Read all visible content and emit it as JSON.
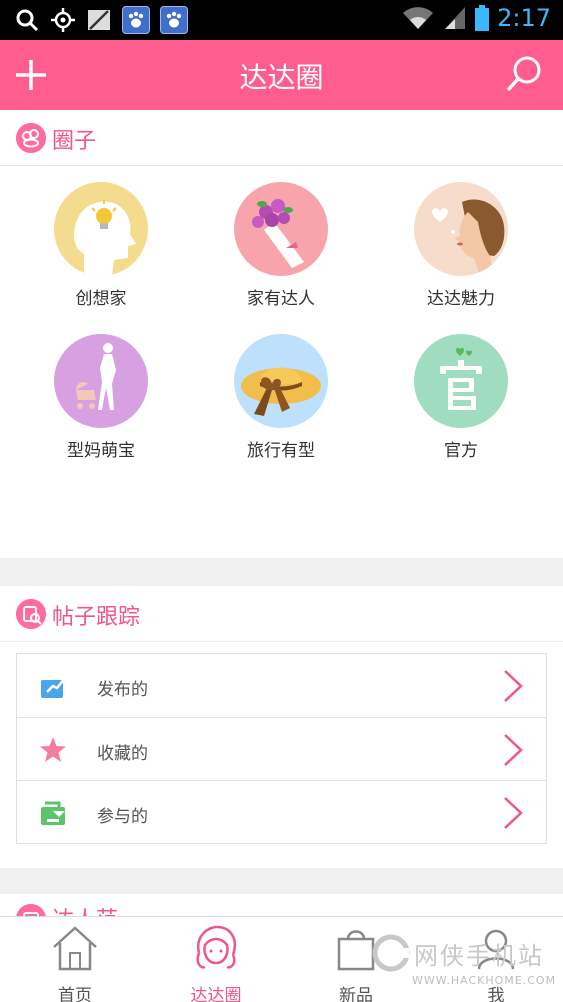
{
  "status_bar": {
    "time": "2:17",
    "notification_icons": [
      "search-icon",
      "gps-icon",
      "no-sim-icon",
      "baidu-paw-icon",
      "baidu-paw-icon"
    ],
    "status_icons": [
      "wifi-icon",
      "signal-icon",
      "battery-icon"
    ]
  },
  "header": {
    "title": "达达圈",
    "left_icon": "plus-icon",
    "right_icon": "search-icon",
    "color": "#ff5d8f"
  },
  "circles_section": {
    "title": "圈子",
    "items": [
      {
        "label": "创想家",
        "icon": "lightbulb-head-icon",
        "bg": "#f3dc8e"
      },
      {
        "label": "家有达人",
        "icon": "bouquet-icon",
        "bg": "#f7a4ad"
      },
      {
        "label": "达达魅力",
        "icon": "woman-profile-icon",
        "bg": "#f6dccb"
      },
      {
        "label": "型妈萌宝",
        "icon": "mother-stroller-icon",
        "bg": "#d7a0e0"
      },
      {
        "label": "旅行有型",
        "icon": "sun-hat-icon",
        "bg": "#bde0fb"
      },
      {
        "label": "官方",
        "icon": "official-icon",
        "bg": "#9fdcc0"
      }
    ]
  },
  "tracking_section": {
    "title": "帖子跟踪",
    "rows": [
      {
        "label": "发布的",
        "icon": "publish-icon"
      },
      {
        "label": "收藏的",
        "icon": "star-icon"
      },
      {
        "label": "参与的",
        "icon": "participate-icon"
      }
    ]
  },
  "partial_section": {
    "title": "达人范"
  },
  "tab_bar": {
    "tabs": [
      {
        "label": "首页",
        "icon": "home-icon",
        "active": false
      },
      {
        "label": "达达圈",
        "icon": "girl-face-icon",
        "active": true
      },
      {
        "label": "新品",
        "icon": "shopping-bag-icon",
        "active": false
      },
      {
        "label": "我",
        "icon": "profile-icon",
        "active": false
      }
    ]
  },
  "watermark": {
    "text": "网侠手机站",
    "url": "WWW.HACKHOME.COM"
  },
  "colors": {
    "accent": "#ff5d8f",
    "section_title": "#f0568a",
    "chevron": "#f0568a"
  }
}
